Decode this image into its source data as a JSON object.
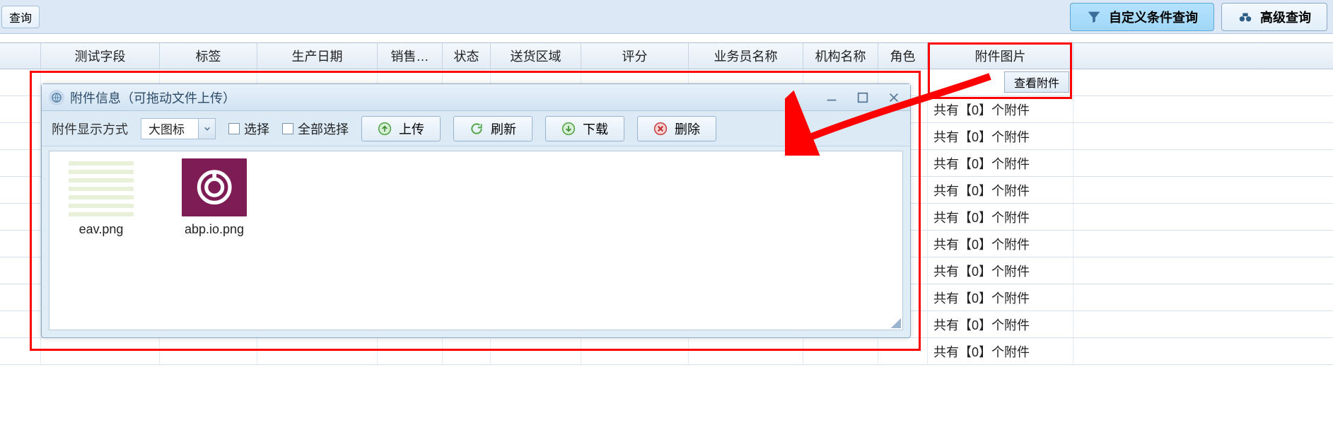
{
  "toolbar": {
    "query_btn": "查询",
    "custom_query_btn": "自定义条件查询",
    "advanced_query_btn": "高级查询"
  },
  "grid": {
    "headers": {
      "c0": "",
      "c1": "测试字段",
      "c2": "标签",
      "c3": "生产日期",
      "c4": "销售…",
      "c5": "状态",
      "c6": "送货区域",
      "c7": "评分",
      "c8": "业务员名称",
      "c9": "机构名称",
      "c10": "角色",
      "c11": "附件图片"
    },
    "attach_rows": [
      "共有【0】个附件",
      "共有【0】个附件",
      "共有【0】个附件",
      "共有【0】个附件",
      "共有【0】个附件",
      "共有【0】个附件",
      "共有【0】个附件",
      "共有【0】个附件",
      "共有【0】个附件",
      "共有【0】个附件"
    ],
    "view_attach_btn": "查看附件"
  },
  "dialog": {
    "title": "附件信息（可拖动文件上传）",
    "display_mode_label": "附件显示方式",
    "display_mode_value": "大图标",
    "checkbox_select": "选择",
    "checkbox_select_all": "全部选择",
    "btn_upload": "上传",
    "btn_refresh": "刷新",
    "btn_download": "下载",
    "btn_delete": "删除",
    "files": [
      {
        "name": "eav.png"
      },
      {
        "name": "abp.io.png"
      }
    ]
  }
}
